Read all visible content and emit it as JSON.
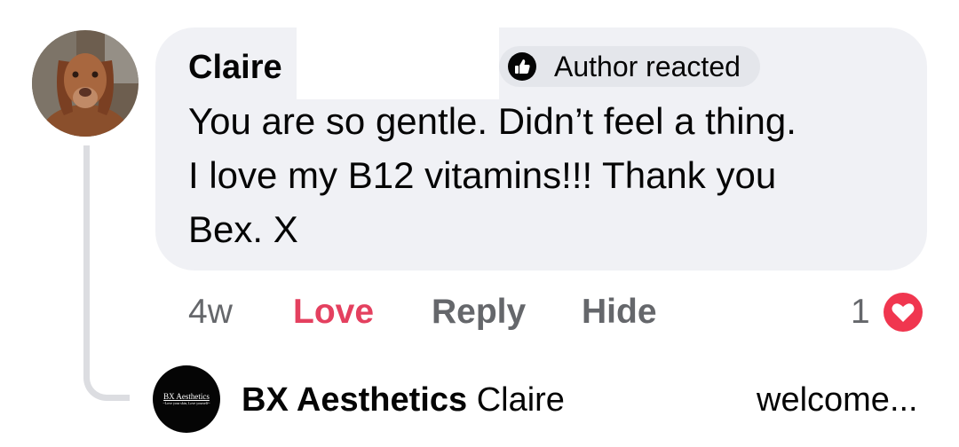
{
  "comment": {
    "author": "Claire",
    "author_badge": "Author reacted",
    "author_badge_icon": "thumbs-up-icon",
    "lines": [
      "You are so gentle. Didn’t feel a thing.",
      "I love my B12 vitamins!!! Thank you",
      "Bex. X"
    ],
    "time": "4w",
    "actions": {
      "love": "Love",
      "reply": "Reply",
      "hide": "Hide"
    },
    "reaction_count": "1",
    "reaction_icon": "heart-icon"
  },
  "reply": {
    "avatar_logo_text": "BX Aesthetics",
    "avatar_logo_subtext": "~Love your skin, Love yourself~",
    "author": "BX Aesthetics",
    "mention": "Claire",
    "preview": "welcome..."
  },
  "colors": {
    "bubble": "#f0f1f5",
    "love": "#e4405f",
    "muted": "#65676b",
    "heart": "#f0364f"
  }
}
